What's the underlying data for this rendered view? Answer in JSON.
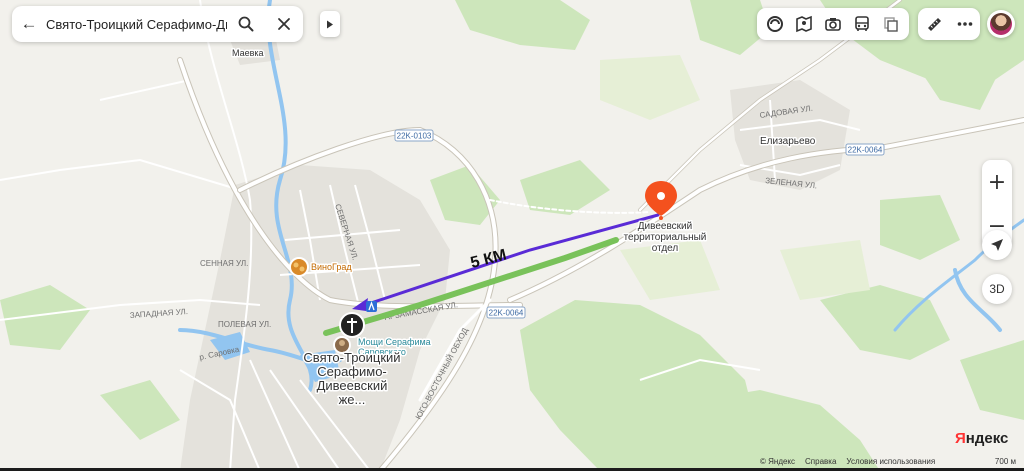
{
  "search": {
    "query": "Свято-Троицкий Серафимо-Дивеевс",
    "back_icon": "arrow-left-icon",
    "search_icon": "search-icon",
    "close_icon": "close-icon"
  },
  "toolbar": {
    "icons": [
      "layers-icon",
      "panorama-icon",
      "camera-icon",
      "transit-icon",
      "pages-icon",
      "ruler-icon",
      "more-icon"
    ]
  },
  "map_controls": {
    "zoom_in": "+",
    "zoom_out": "−",
    "three_d": "3D"
  },
  "annotation": {
    "distance_label": "5 КМ"
  },
  "places": {
    "destination": "Дивеевский территориальный отдел",
    "destination_line1": "Дивеевский",
    "destination_line2": "территориальный",
    "destination_line3": "отдел",
    "monastery_line1": "Свято-Троицкий",
    "monastery_line2": "Серафимо-",
    "monastery_line3": "Дивеевский",
    "monastery_line4": "же...",
    "relics_line1": "Мощи Серафима",
    "relics_line2": "Саровского",
    "shop": "ВиноГрад",
    "village_maevka": "Маевка",
    "village_elizarevo": "Елизарьево"
  },
  "roads": {
    "hwy1": "22K-0103",
    "hwy2": "22K-0064",
    "hwy3": "22K-0064",
    "sadovaya": "САДОВАЯ УЛ.",
    "zelenaya": "ЗЕЛЕНАЯ УЛ.",
    "senaya": "СЕННАЯ УЛ.",
    "zapadnaya": "ЗАПАДНАЯ УЛ.",
    "polevaya": "ПОЛЕВАЯ УЛ.",
    "arzamasskaya": "АРЗАМАССКАЯ УЛ.",
    "vostochny": "ЮГО-ВОСТОЧНЫЙ ОБХОД",
    "severnaya": "СЕВЕРНАЯ УЛ.",
    "sarovka": "р. Саровка"
  },
  "footer": {
    "copyright": "© Яндекс",
    "help": "Справка",
    "terms": "Условия использования",
    "scale": "700 м"
  },
  "logo": {
    "first": "Я",
    "rest": "ндекс"
  },
  "colors": {
    "route_purple": "#5a2bd6",
    "route_green": "#79c25a",
    "pin": "#f4511e",
    "water": "#92c5f0",
    "forest": "#cde6bb"
  }
}
